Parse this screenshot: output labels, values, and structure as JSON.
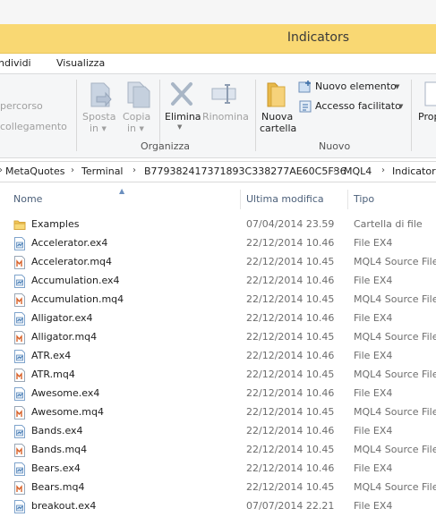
{
  "window": {
    "title": "Indicators"
  },
  "tabs": [
    "ndividi",
    "Visualizza"
  ],
  "ribbon": {
    "percorso": "percorso",
    "collegamento": "collegamento",
    "sposta": [
      "Sposta",
      "in"
    ],
    "copia": [
      "Copia",
      "in"
    ],
    "elimina": "Elimina",
    "rinomina": "Rinomina",
    "nuova_cartella": [
      "Nuova",
      "cartella"
    ],
    "nuovo_elemento": "Nuovo elemento",
    "accesso_facilitato": "Accesso facilitato",
    "proprieta": "Prop",
    "groups": {
      "organizza": "Organizza",
      "nuovo": "Nuovo"
    }
  },
  "breadcrumb": [
    "MetaQuotes",
    "Terminal",
    "B779382417371893C338277AE60C5F36",
    "MQL4",
    "Indicator"
  ],
  "columns": {
    "name": "Nome",
    "modified": "Ultima modifica",
    "type": "Tipo"
  },
  "files": [
    {
      "name": "Examples",
      "modified": "07/04/2014 23.59",
      "type": "Cartella di file",
      "icon": "folder-icon"
    },
    {
      "name": "Accelerator.ex4",
      "modified": "22/12/2014 10.46",
      "type": "File EX4",
      "icon": "ex4-file-icon"
    },
    {
      "name": "Accelerator.mq4",
      "modified": "22/12/2014 10.45",
      "type": "MQL4 Source File",
      "icon": "mq4-file-icon"
    },
    {
      "name": "Accumulation.ex4",
      "modified": "22/12/2014 10.46",
      "type": "File EX4",
      "icon": "ex4-file-icon"
    },
    {
      "name": "Accumulation.mq4",
      "modified": "22/12/2014 10.45",
      "type": "MQL4 Source File",
      "icon": "mq4-file-icon"
    },
    {
      "name": "Alligator.ex4",
      "modified": "22/12/2014 10.46",
      "type": "File EX4",
      "icon": "ex4-file-icon"
    },
    {
      "name": "Alligator.mq4",
      "modified": "22/12/2014 10.45",
      "type": "MQL4 Source File",
      "icon": "mq4-file-icon"
    },
    {
      "name": "ATR.ex4",
      "modified": "22/12/2014 10.46",
      "type": "File EX4",
      "icon": "ex4-file-icon"
    },
    {
      "name": "ATR.mq4",
      "modified": "22/12/2014 10.45",
      "type": "MQL4 Source File",
      "icon": "mq4-file-icon"
    },
    {
      "name": "Awesome.ex4",
      "modified": "22/12/2014 10.46",
      "type": "File EX4",
      "icon": "ex4-file-icon"
    },
    {
      "name": "Awesome.mq4",
      "modified": "22/12/2014 10.45",
      "type": "MQL4 Source File",
      "icon": "mq4-file-icon"
    },
    {
      "name": "Bands.ex4",
      "modified": "22/12/2014 10.46",
      "type": "File EX4",
      "icon": "ex4-file-icon"
    },
    {
      "name": "Bands.mq4",
      "modified": "22/12/2014 10.45",
      "type": "MQL4 Source File",
      "icon": "mq4-file-icon"
    },
    {
      "name": "Bears.ex4",
      "modified": "22/12/2014 10.46",
      "type": "File EX4",
      "icon": "ex4-file-icon"
    },
    {
      "name": "Bears.mq4",
      "modified": "22/12/2014 10.45",
      "type": "MQL4 Source File",
      "icon": "mq4-file-icon"
    },
    {
      "name": "breakout.ex4",
      "modified": "07/07/2014 22.21",
      "type": "File EX4",
      "icon": "ex4-file-icon"
    }
  ]
}
